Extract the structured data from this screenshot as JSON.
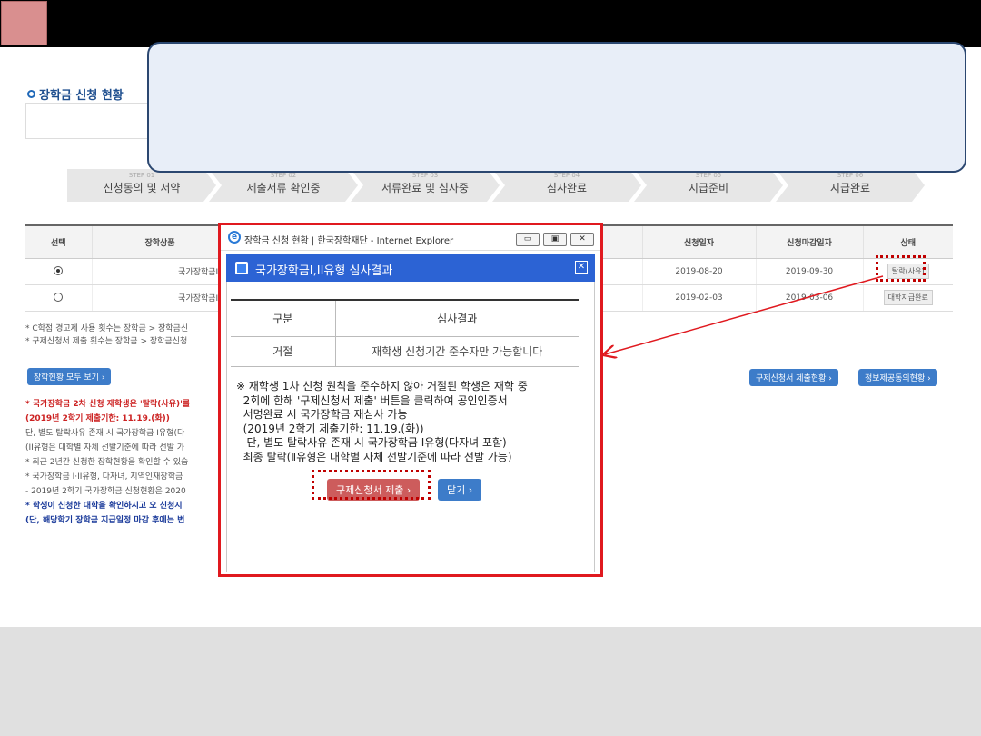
{
  "page": {
    "title": "장학금 신청 현황",
    "steps": [
      {
        "num": "STEP 01",
        "label": "신청동의 및 서약"
      },
      {
        "num": "STEP 02",
        "label": "제출서류 확인중"
      },
      {
        "num": "STEP 03",
        "label": "서류완료 및 심사중"
      },
      {
        "num": "STEP 04",
        "label": "심사완료"
      },
      {
        "num": "STEP 05",
        "label": "지급준비"
      },
      {
        "num": "STEP 06",
        "label": "지급완료"
      }
    ],
    "table": {
      "headers": {
        "select": "선택",
        "product": "장학상품",
        "apply_date": "신청일자",
        "deadline": "신청마감일자",
        "status": "상태"
      },
      "rows": [
        {
          "product": "국가장학금I유",
          "apply_date": "2019-08-20",
          "deadline": "2019-09-30",
          "status": "탈락(사유)",
          "selected": true
        },
        {
          "product": "국가장학금I유",
          "apply_date": "2019-02-03",
          "deadline": "2019-03-06",
          "status": "대학지급완료",
          "selected": false
        }
      ]
    },
    "notes": [
      "* C학점 경고제 사용 횟수는 장학금 > 장학금신",
      "* 구제신청서 제출 횟수는 장학금 > 장학금신청"
    ],
    "buttons": {
      "view_all": "장학현황 모두 보기",
      "appeal_status": "구제신청서 제출현황",
      "consent_status": "정보제공동의현황"
    },
    "notes2": [
      {
        "cls": "red",
        "text": "* 국가장학금 2차 신청 재학생은 '탈락(사유)'를"
      },
      {
        "cls": "red",
        "text": "  (2019년 2학기 제출기한: 11.19.(화))"
      },
      {
        "cls": "gray",
        "text": "  단, 별도 탈락사유 존재 시 국가장학금 I유형(다"
      },
      {
        "cls": "gray",
        "text": "  (II유형은 대학별 자체 선발기준에 따라 선발 가"
      },
      {
        "cls": "gray",
        "text": "* 최근 2년간 신청한 장학현황을 확인할 수 있습"
      },
      {
        "cls": "gray",
        "text": "* 국가장학금 I·II유형, 다자녀, 지역인재장학금"
      },
      {
        "cls": "gray",
        "text": "  - 2019년 2학기 국가장학금 신청현황은 2020"
      },
      {
        "cls": "blue",
        "text": "* 학생이 신청한 대학을 확인하시고 오 신청시"
      },
      {
        "cls": "blue",
        "text": "  (단, 해당학기 장학금 지급일정 마감 후에는 변"
      }
    ]
  },
  "popup": {
    "window_title": "장학금 신청 현황 | 한국장학재단 - Internet Explorer",
    "header_title": "국가장학금I,II유형 심사결과",
    "result_headers": {
      "category": "구분",
      "result": "심사결과"
    },
    "result_row": {
      "category": "거절",
      "result": "재학생 신청기간 준수자만 가능합니다"
    },
    "note": "※ 재학생 1차 신청 원칙을 준수하지 않아 거절된 학생은 재학 중\n  2회에 한해 '구제신청서 제출' 버튼을 클릭하여 공인인증서\n  서명완료 시 국가장학금 재심사 가능\n  (2019년 2학기 제출기한: 11.19.(화))\n   단, 별도 탈락사유 존재 시 국가장학금 Ⅰ유형(다자녀 포함)\n  최종 탈락(Ⅱ유형은 대학별 자체 선발기준에 따라 선발 가능)",
    "appeal_button": "구제신청서 제출",
    "close_button": "닫기"
  },
  "colors": {
    "highlight": "#e0191f",
    "accent_blue": "#2c63d4",
    "callout_border": "#2b4770"
  },
  "icons": [
    "ie-icon",
    "popup-window-icon",
    "close-icon",
    "chevron-right-icon",
    "radio-icon"
  ]
}
